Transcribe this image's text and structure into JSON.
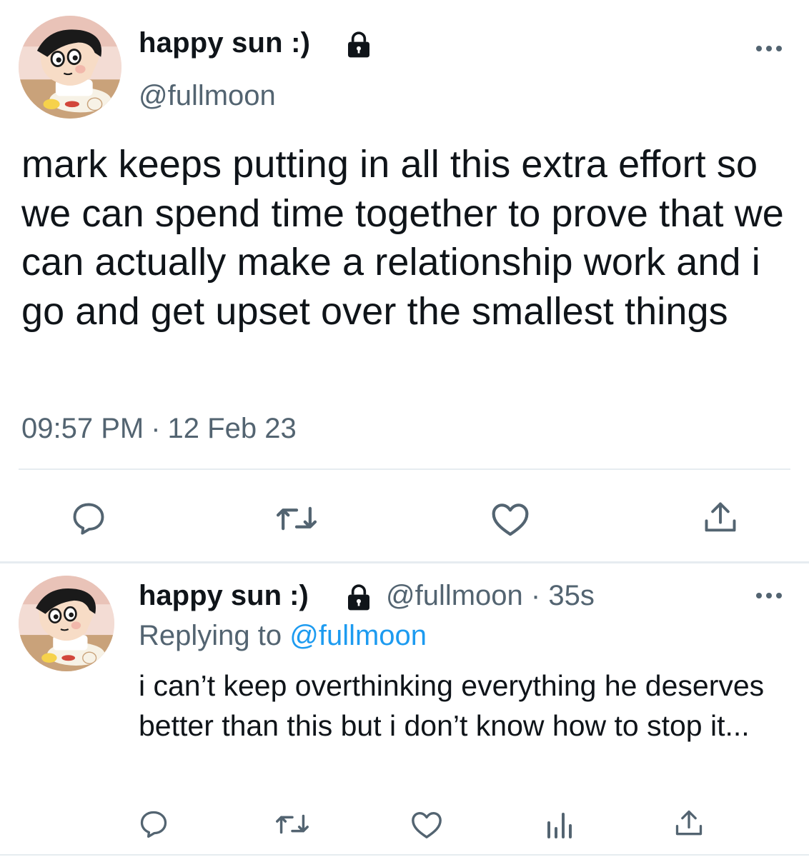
{
  "main_tweet": {
    "display_name": "happy sun :)",
    "handle": "@fullmoon",
    "text": "mark keeps putting in all this extra effort so we can spend time together to prove that we can actually make a relationship work and i go and get upset over the smallest things",
    "time": "09:57 PM",
    "date": "12 Feb 23",
    "separator": "·",
    "avatar_icon": "cartoon-boy-avatar",
    "lock_icon": "lock-icon",
    "actions": [
      "reply-icon",
      "retweet-icon",
      "like-icon",
      "share-icon"
    ]
  },
  "reply_tweet": {
    "display_name": "happy sun :)",
    "handle": "@fullmoon",
    "separator": "·",
    "age": "35s",
    "replying_label": "Replying to",
    "replying_to": "@fullmoon",
    "text": "i can’t keep overthinking everything he deserves better than this but i don’t know how to stop it...",
    "avatar_icon": "cartoon-boy-avatar",
    "lock_icon": "lock-icon",
    "actions": [
      "reply-icon",
      "retweet-icon",
      "like-icon",
      "analytics-icon",
      "share-icon"
    ]
  },
  "colors": {
    "text_primary": "#0f1419",
    "text_secondary": "#536471",
    "link": "#1d9bf0",
    "divider": "#e6ecf0",
    "icon": "#536471"
  }
}
